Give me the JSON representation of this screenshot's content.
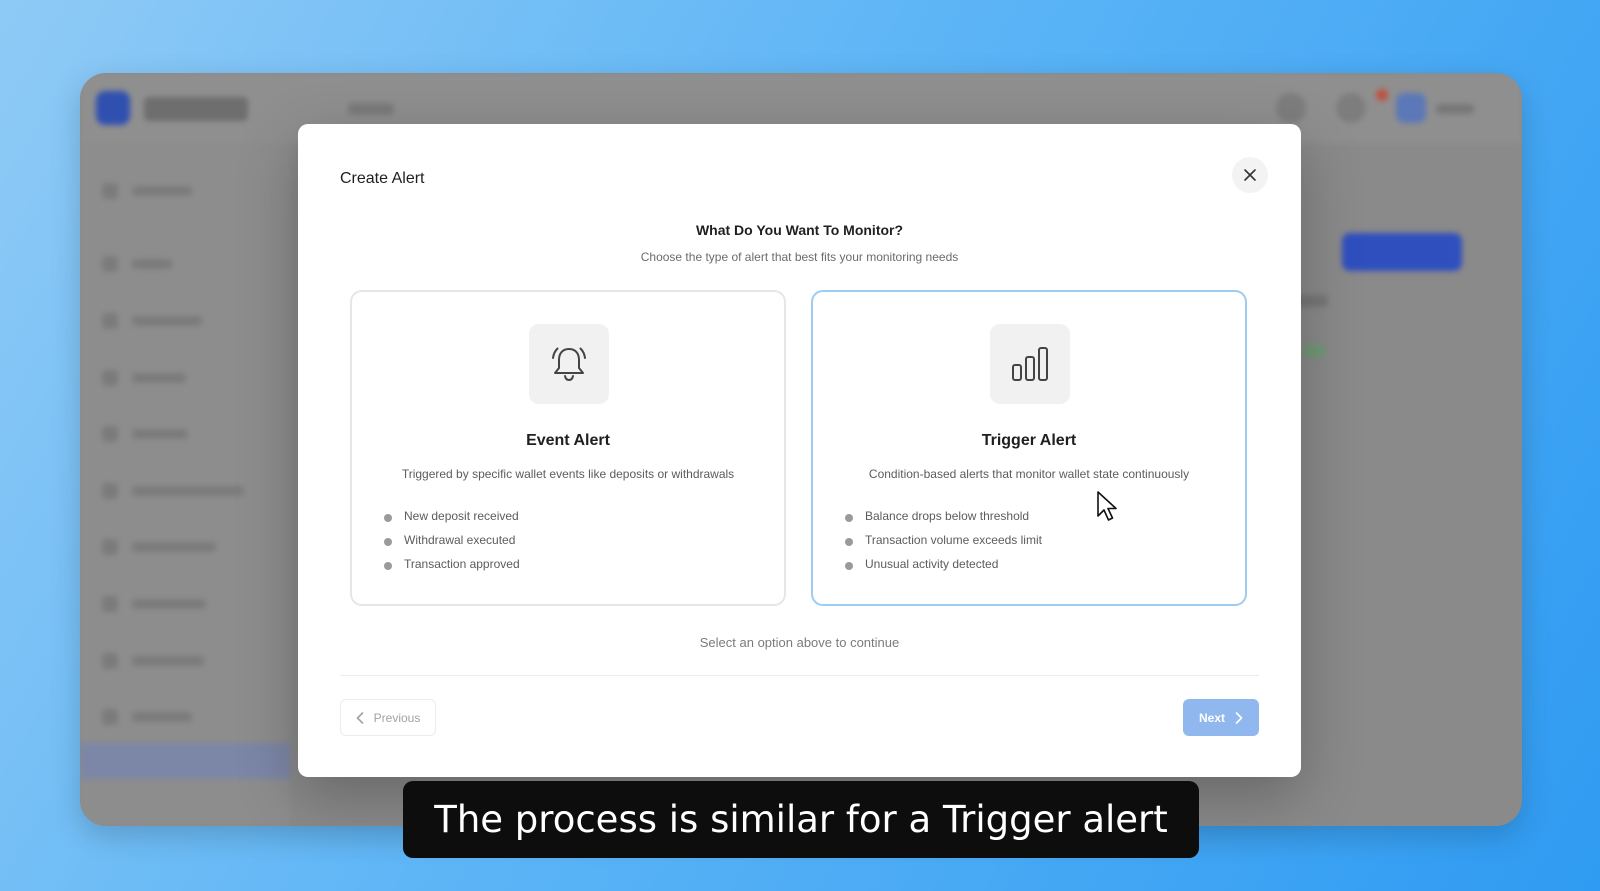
{
  "modal": {
    "title": "Create Alert",
    "heading": "What Do You Want To Monitor?",
    "subheading": "Choose the type of alert that best fits your monitoring needs",
    "hint": "Select an option above to continue",
    "close_icon": "close-icon"
  },
  "options": [
    {
      "icon": "bell-icon",
      "title": "Event Alert",
      "description": "Triggered by specific wallet events like deposits or withdrawals",
      "examples": [
        "New deposit received",
        "Withdrawal executed",
        "Transaction approved"
      ]
    },
    {
      "icon": "bar-chart-icon",
      "title": "Trigger Alert",
      "description": "Condition-based alerts that monitor wallet state continuously",
      "examples": [
        "Balance drops below threshold",
        "Transaction volume exceeds limit",
        "Unusual activity detected"
      ]
    }
  ],
  "footer": {
    "previous_label": "Previous",
    "next_label": "Next"
  },
  "caption": "The process is similar for a Trigger alert",
  "colors": {
    "accent_hover_border": "#9ecbf1",
    "next_button": "#90b7ee"
  }
}
